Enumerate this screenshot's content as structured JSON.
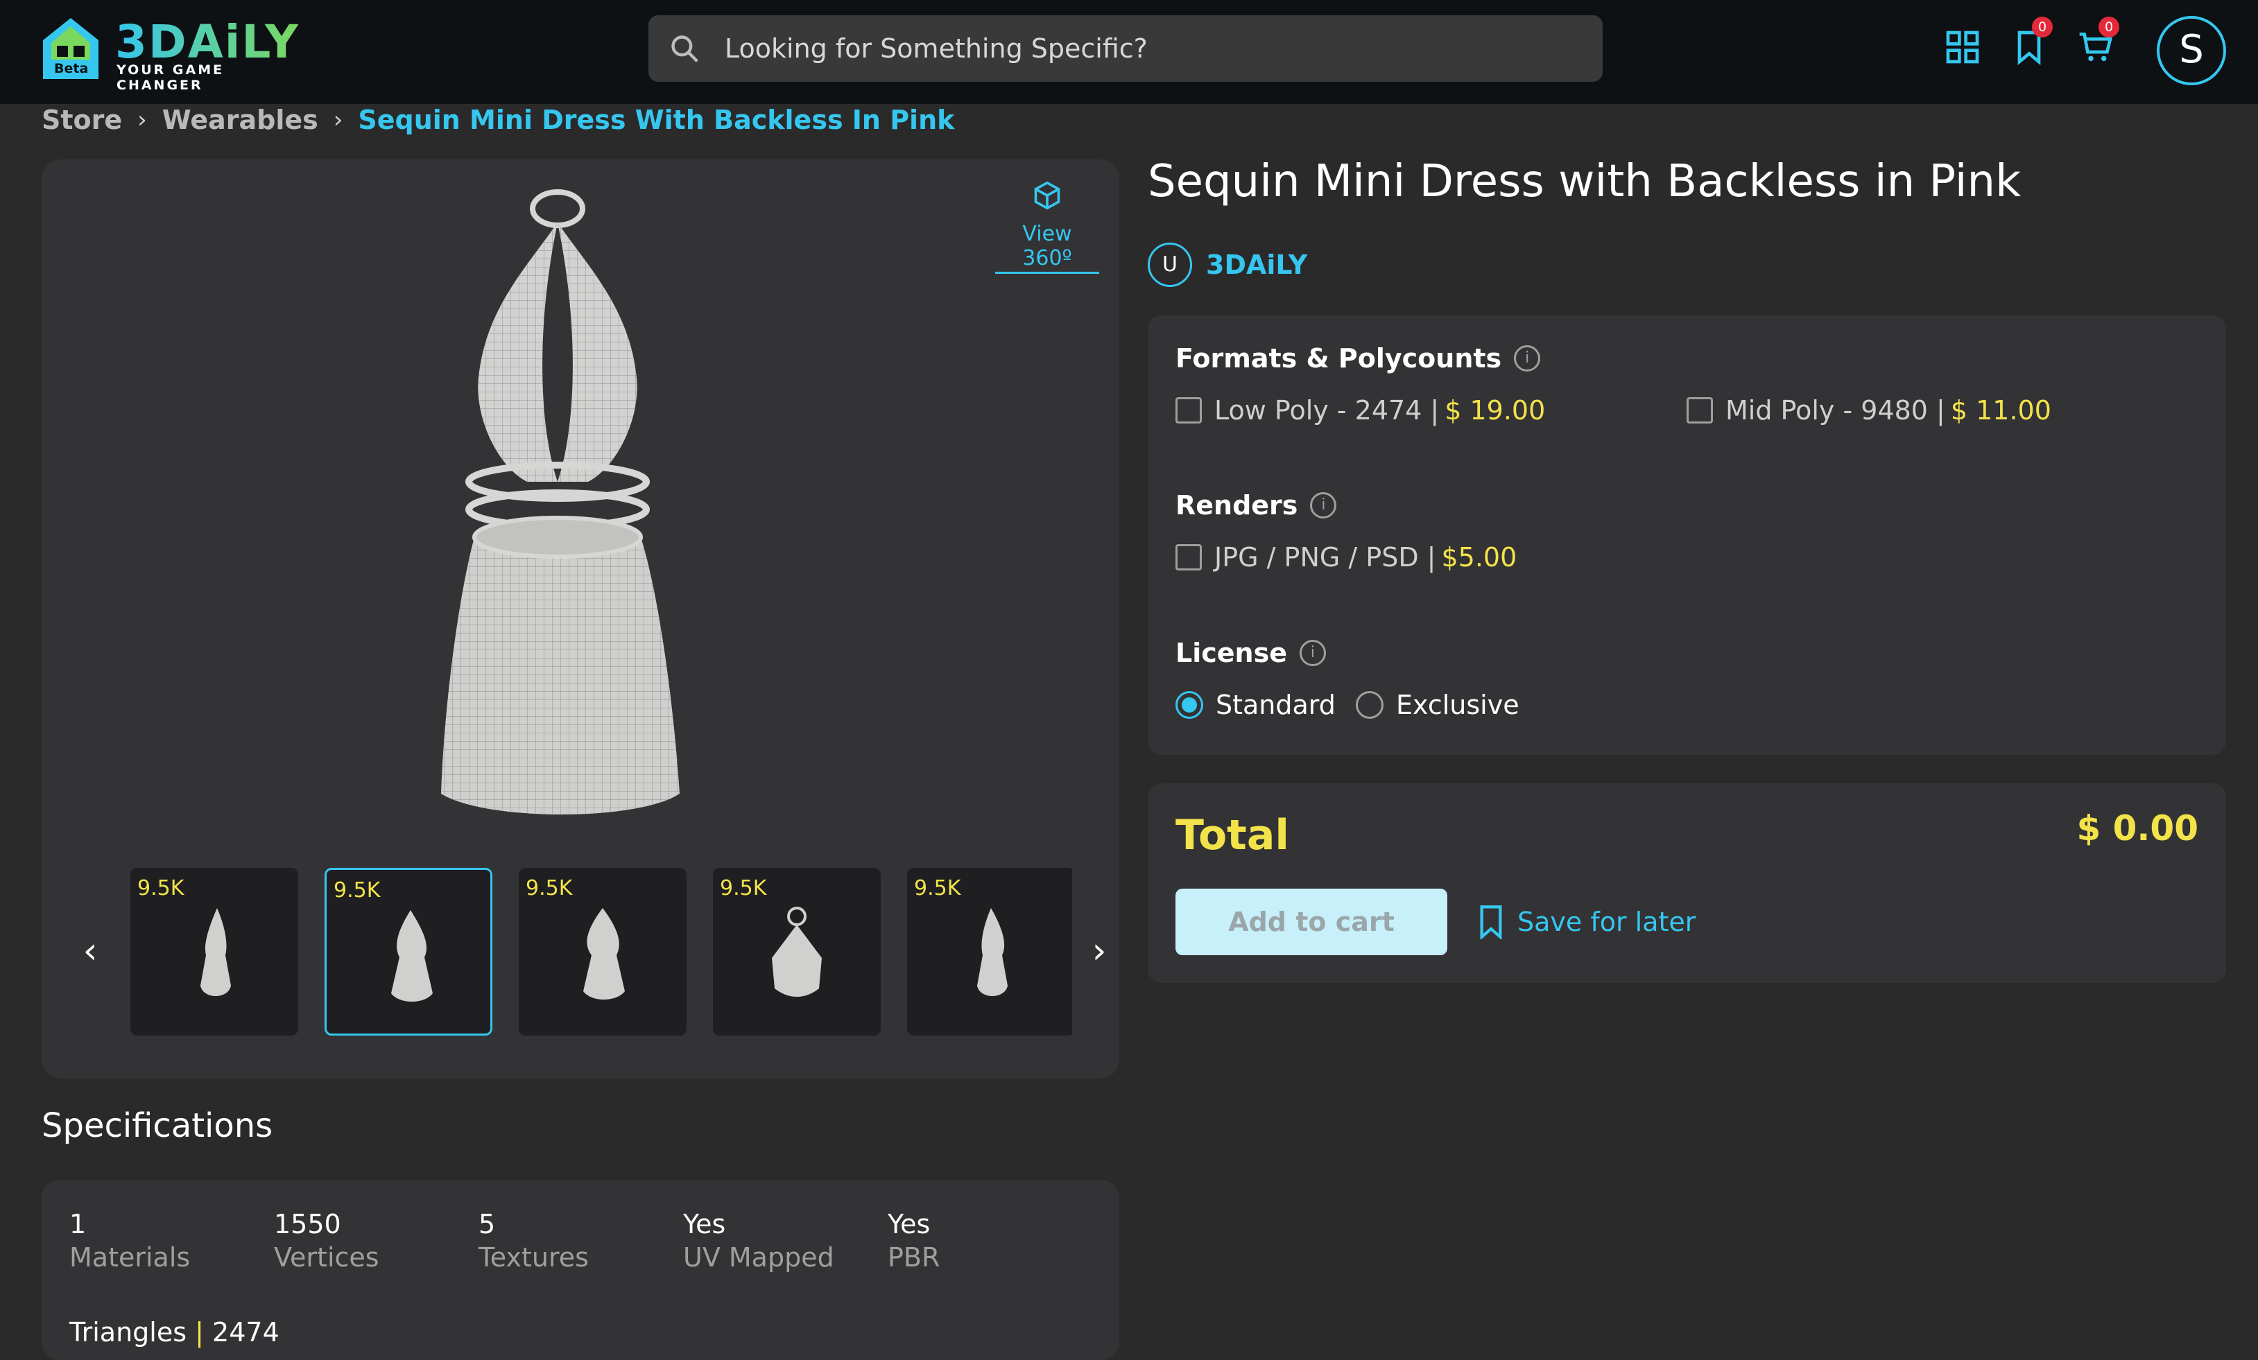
{
  "brand": {
    "name": "3DAiLY",
    "tagline": "YOUR GAME CHANGER",
    "beta": "Beta"
  },
  "search": {
    "placeholder": "Looking for Something Specific?"
  },
  "header": {
    "wishlist_count": "0",
    "cart_count": "0",
    "avatar_letter": "S"
  },
  "breadcrumb": {
    "items": [
      "Store",
      "Wearables",
      "Sequin Mini Dress With Backless In Pink"
    ]
  },
  "viewer": {
    "view360_label": "View 360º",
    "thumbnails": [
      {
        "count": "9.5K"
      },
      {
        "count": "9.5K"
      },
      {
        "count": "9.5K"
      },
      {
        "count": "9.5K"
      },
      {
        "count": "9.5K"
      }
    ]
  },
  "product": {
    "title": "Sequin Mini Dress with Backless in Pink",
    "author_initial": "U",
    "author": "3DAiLY"
  },
  "options": {
    "formats_title": "Formats & Polycounts",
    "formats": [
      {
        "label": "Low Poly - 2474 |",
        "price": "$ 19.00"
      },
      {
        "label": "Mid Poly - 9480 |",
        "price": "$ 11.00"
      }
    ],
    "renders_title": "Renders",
    "renders": [
      {
        "label": "JPG / PNG / PSD |",
        "price": "$5.00"
      }
    ],
    "license_title": "License",
    "licenses": [
      {
        "label": "Standard",
        "selected": true
      },
      {
        "label": "Exclusive",
        "selected": false
      }
    ]
  },
  "total": {
    "label": "Total",
    "value": "$ 0.00",
    "add_to_cart": "Add to cart",
    "save_for_later": "Save for later"
  },
  "specifications": {
    "title": "Specifications",
    "items": [
      {
        "value": "1",
        "label": "Materials"
      },
      {
        "value": "1550",
        "label": "Vertices"
      },
      {
        "value": "5",
        "label": "Textures"
      },
      {
        "value": "Yes",
        "label": "UV Mapped"
      },
      {
        "value": "Yes",
        "label": "PBR"
      }
    ],
    "triangles_label": "Triangles",
    "triangles_sep": "|",
    "triangles_value": "2474"
  },
  "colors": {
    "accent": "#35c7ef",
    "price": "#f3e34a",
    "background": "#2b2a2b",
    "panel": "#333234"
  }
}
